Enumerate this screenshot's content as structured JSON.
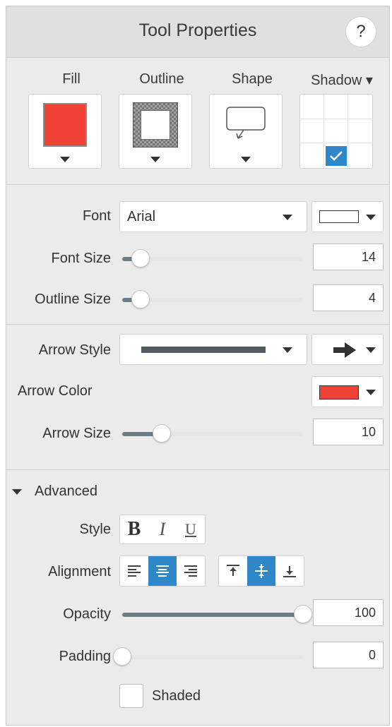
{
  "panel": {
    "title": "Tool Properties",
    "help_label": "?"
  },
  "style_tiles": {
    "fill": {
      "label": "Fill",
      "color": "#f04136"
    },
    "outline": {
      "label": "Outline"
    },
    "shape": {
      "label": "Shape"
    },
    "shadow": {
      "label": "Shadow ▾",
      "selected_cell": "bottom-center"
    }
  },
  "font": {
    "label": "Font",
    "value": "Arial",
    "color": "#ffffff"
  },
  "font_size": {
    "label": "Font Size",
    "value": "14",
    "level": 0.1
  },
  "outline_size": {
    "label": "Outline Size",
    "value": "4",
    "level": 0.1
  },
  "arrow_style": {
    "label": "Arrow Style",
    "line_color": "#4f5b61",
    "end": "right-arrow-icon"
  },
  "arrow_color": {
    "label": "Arrow Color",
    "color": "#f04136"
  },
  "arrow_size": {
    "label": "Arrow Size",
    "value": "10",
    "level": 0.22
  },
  "advanced": {
    "label": "Advanced",
    "style": {
      "label": "Style",
      "bold": "B",
      "italic": "I",
      "underline": "U"
    },
    "alignment": {
      "label": "Alignment",
      "horizontal_selected": "center",
      "vertical_selected": "middle"
    },
    "opacity": {
      "label": "Opacity",
      "value": "100",
      "level": 1.0
    },
    "padding": {
      "label": "Padding",
      "value": "0",
      "level": 0.0
    },
    "shaded": {
      "label": "Shaded",
      "checked": false
    }
  },
  "accent_color": "#2e88c8"
}
